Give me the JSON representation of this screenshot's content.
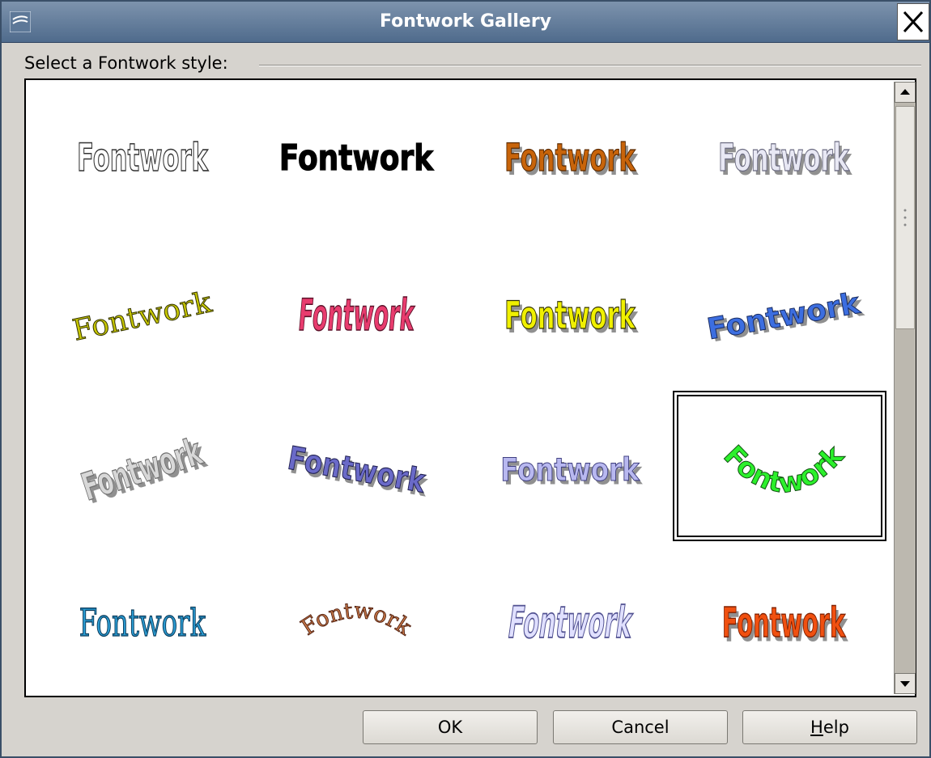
{
  "window": {
    "title": "Fontwork Gallery"
  },
  "section": {
    "label": "Select a Fontwork style:"
  },
  "gallery": {
    "selected_index": 11,
    "items": [
      {
        "text": "Fontwork",
        "style": "outline",
        "fill": "#ffffff",
        "stroke": "#333333"
      },
      {
        "text": "Fontwork",
        "style": "arch-black",
        "fill": "#000000",
        "stroke": "#000000"
      },
      {
        "text": "Fontwork",
        "style": "gold-gradient",
        "fill": "#c8640a",
        "stroke": "#5a2a00"
      },
      {
        "text": "Fontwork",
        "style": "silver-shadow",
        "fill": "#e8e8f4",
        "stroke": "#6a6a80"
      },
      {
        "text": "Fontwork",
        "style": "slant-olive",
        "fill": "#c8c800",
        "stroke": "#333300"
      },
      {
        "text": "Fontwork",
        "style": "perspective-pink",
        "fill": "#e83c6e",
        "stroke": "#5a1028"
      },
      {
        "text": "Fontwork",
        "style": "yellow-bold",
        "fill": "#f0f000",
        "stroke": "#303000"
      },
      {
        "text": "Fontwork",
        "style": "blue-wave",
        "fill": "#3c6ee0",
        "stroke": "#1a2c60"
      },
      {
        "text": "Fontwork",
        "style": "grey-3d",
        "fill": "#d8d8d8",
        "stroke": "#707070"
      },
      {
        "text": "Fontwork",
        "style": "purple-3d",
        "fill": "#6a6ac8",
        "stroke": "#202050"
      },
      {
        "text": "Fontwork",
        "style": "lavender-3d",
        "fill": "#b8b8f0",
        "stroke": "#404080"
      },
      {
        "text": "Fontwork",
        "style": "green-arc",
        "fill": "#2cf02c",
        "stroke": "#105010"
      },
      {
        "text": "Fontwork",
        "style": "teal-plain",
        "fill": "#2a9ad0",
        "stroke": "#0a3a5a"
      },
      {
        "text": "Fontwork",
        "style": "copper-arc",
        "fill": "#c87848",
        "stroke": "#502010"
      },
      {
        "text": "Fontwork",
        "style": "lilac-outline",
        "fill": "#e0e0ff",
        "stroke": "#505090"
      },
      {
        "text": "Fontwork",
        "style": "fire-gradient",
        "fill": "#f05010",
        "stroke": "#802000"
      }
    ]
  },
  "buttons": {
    "ok": "OK",
    "cancel": "Cancel",
    "help_mnemonic": "H",
    "help_rest": "elp"
  }
}
